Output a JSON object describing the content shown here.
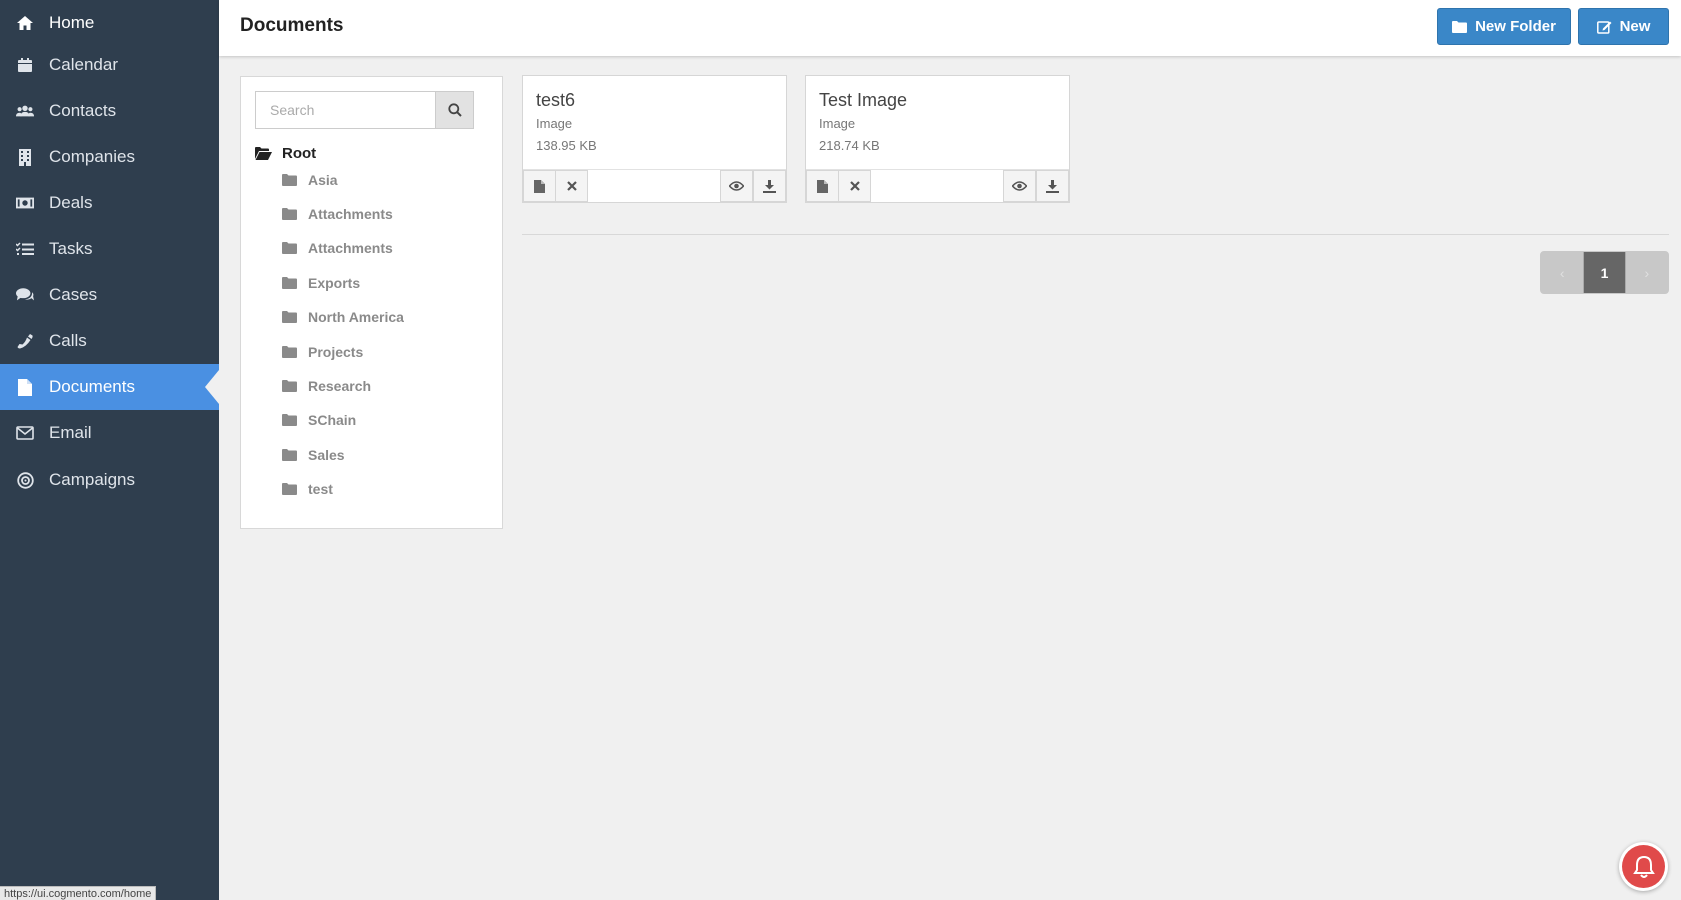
{
  "sidebar": {
    "items": [
      {
        "label": "Home",
        "icon": "home-icon"
      },
      {
        "label": "Calendar",
        "icon": "calendar-icon"
      },
      {
        "label": "Contacts",
        "icon": "users-icon"
      },
      {
        "label": "Companies",
        "icon": "building-icon"
      },
      {
        "label": "Deals",
        "icon": "money-icon"
      },
      {
        "label": "Tasks",
        "icon": "tasks-icon"
      },
      {
        "label": "Cases",
        "icon": "comments-icon"
      },
      {
        "label": "Calls",
        "icon": "phone-icon"
      },
      {
        "label": "Documents",
        "icon": "file-icon",
        "active": true
      },
      {
        "label": "Email",
        "icon": "envelope-icon"
      },
      {
        "label": "Campaigns",
        "icon": "bullseye-icon"
      }
    ]
  },
  "header": {
    "title": "Documents",
    "new_folder_label": "New Folder",
    "new_label": "New"
  },
  "tree": {
    "search_placeholder": "Search",
    "root_label": "Root",
    "folders": [
      "Asia",
      "Attachments",
      "Attachments",
      "Exports",
      "North America",
      "Projects",
      "Research",
      "SChain",
      "Sales",
      "test"
    ]
  },
  "documents": [
    {
      "name": "test6",
      "type": "Image",
      "size": "138.95 KB"
    },
    {
      "name": "Test Image",
      "type": "Image",
      "size": "218.74 KB"
    }
  ],
  "pagination": {
    "current": "1"
  },
  "status_bar": {
    "url": "https://ui.cogmento.com/home"
  },
  "colors": {
    "sidebar_bg": "#2f3e4e",
    "active_nav": "#4a90e2",
    "button_blue": "#3a87c8",
    "notification_red": "#e04a4a"
  }
}
